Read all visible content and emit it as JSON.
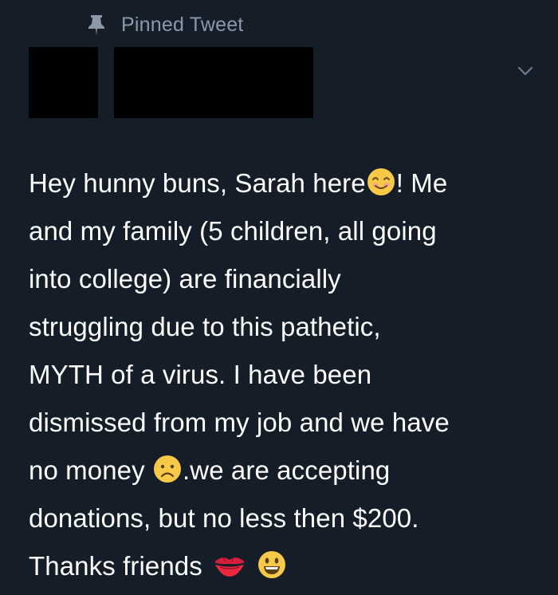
{
  "pinned": {
    "label": "Pinned Tweet",
    "icon": "pin-icon"
  },
  "header": {
    "avatar": "redacted",
    "name": "redacted",
    "menu_icon": "chevron-down-icon"
  },
  "tweet": {
    "lines": [
      {
        "before": "Hey hunny buns, Sarah here",
        "emoji": "smiling-face-icon",
        "after": "! Me"
      },
      {
        "text": "and my family (5 children, all going"
      },
      {
        "text": "into college) are financially"
      },
      {
        "text": "struggling due to this pathetic,"
      },
      {
        "text": "MYTH of a virus. I have been"
      },
      {
        "text": "dismissed from my job and we have"
      },
      {
        "before": "no money ",
        "emoji": "frowning-face-icon",
        "after": ".we are accepting"
      },
      {
        "text": "donations, but no less then $200."
      },
      {
        "before": "Thanks friends",
        "emoji": [
          "kiss-mark-icon",
          "grinning-face-icon"
        ]
      }
    ]
  },
  "colors": {
    "background": "#151d28",
    "muted": "#8a98a8",
    "text": "#ffffff"
  }
}
